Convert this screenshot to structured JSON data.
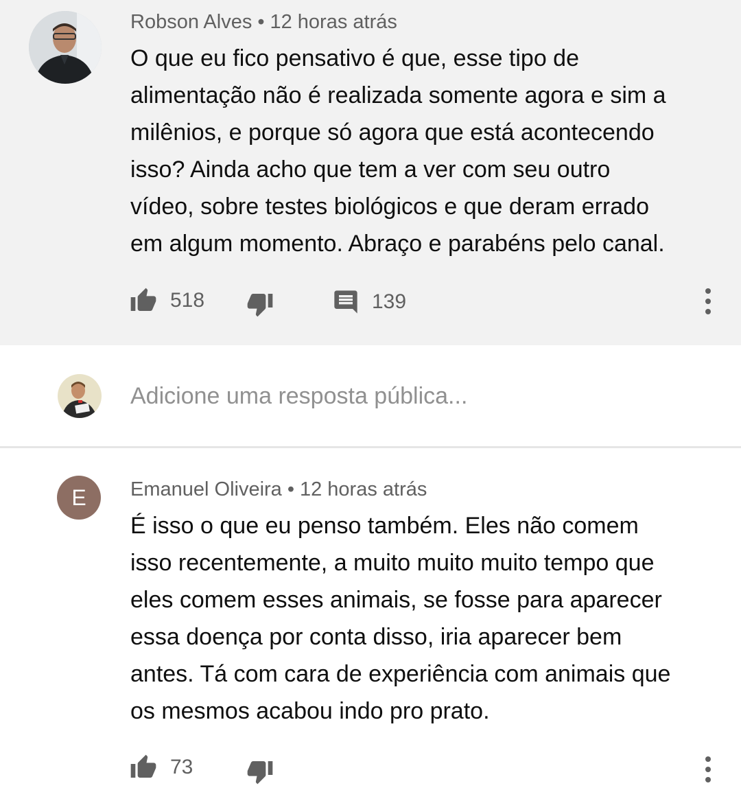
{
  "comment1": {
    "author": "Robson Alves",
    "separator": "•",
    "time": "12 horas atrás",
    "lines": [
      "O que eu fico pensativo é que, esse tipo de",
      "alimentação não é realizada somente agora e sim a",
      "milênios, e porque só agora que está acontecendo",
      "isso? Ainda acho que tem a ver com seu outro",
      "vídeo, sobre testes biológicos e que deram errado",
      "em algum momento. Abraço e parabéns pelo canal."
    ],
    "likes": "518",
    "replies": "139"
  },
  "reply_box": {
    "placeholder": "Adicione uma resposta pública..."
  },
  "comment2": {
    "author": "Emanuel Oliveira",
    "separator": "•",
    "time": "12 horas atrás",
    "avatar_letter": "E",
    "lines": [
      "É isso o que eu penso também. Eles não comem",
      "isso recentemente, a muito muito muito tempo que",
      "eles comem esses animais, se fosse para aparecer",
      "essa doença por conta disso, iria aparecer bem",
      "antes. Tá com cara de experiência com animais que",
      "os mesmos acabou indo pro prato."
    ],
    "likes": "73"
  },
  "colors": {
    "highlight_background": "#f2f2f2",
    "meta_text": "#606060",
    "letter_avatar": "#8d6e63"
  }
}
